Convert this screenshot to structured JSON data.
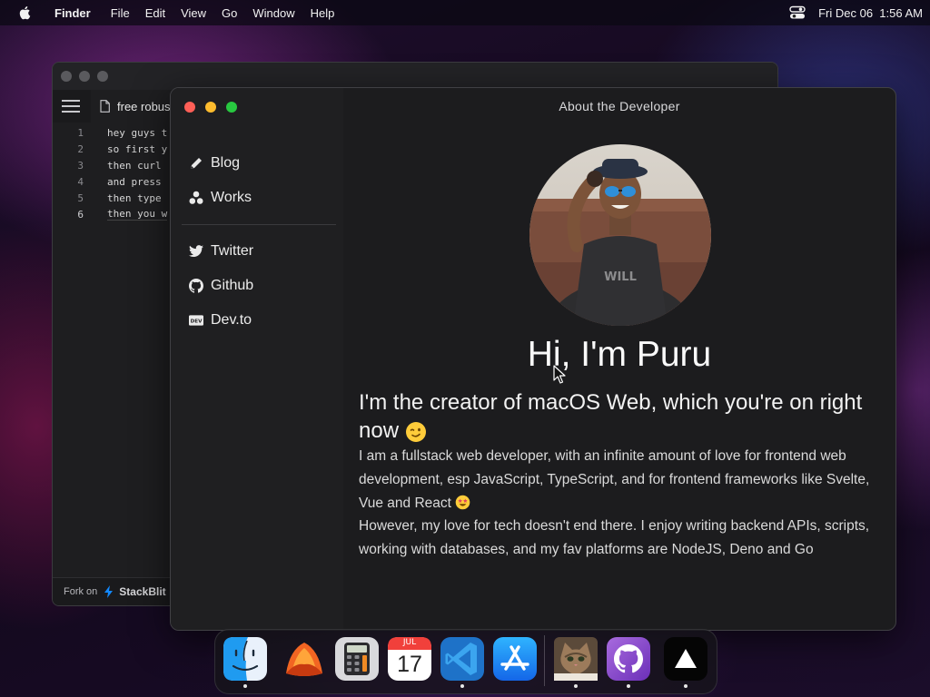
{
  "menubar": {
    "app_name": "Finder",
    "menus": [
      "File",
      "Edit",
      "View",
      "Go",
      "Window",
      "Help"
    ],
    "datetime": "Fri Dec 06  1:56 AM"
  },
  "editor": {
    "tab_label": "free robus",
    "lines": [
      {
        "num": "1",
        "text": "hey guys t"
      },
      {
        "num": "2",
        "text": "so first y"
      },
      {
        "num": "3",
        "text": "then curl"
      },
      {
        "num": "4",
        "text": "and press"
      },
      {
        "num": "5",
        "text": "then type"
      },
      {
        "num": "6",
        "text": "then you w"
      }
    ],
    "footer_fork": "Fork on",
    "footer_brand": "StackBlit"
  },
  "about": {
    "window_title": "About the Developer",
    "nav": [
      {
        "label": "Blog",
        "icon": "pencil-icon"
      },
      {
        "label": "Works",
        "icon": "works-icon"
      },
      {
        "label": "Twitter",
        "icon": "twitter-icon"
      },
      {
        "label": "Github",
        "icon": "github-icon"
      },
      {
        "label": "Dev.to",
        "icon": "devto-icon"
      }
    ],
    "heading": "Hi, I'm Puru",
    "subheading": "I'm the creator of macOS Web, which you're on right now",
    "paragraph1": "I am a fullstack web developer, with an infinite amount of love for frontend web development, esp JavaScript, TypeScript, and for frontend frameworks like Svelte, Vue and React",
    "paragraph2": "However, my love for tech doesn't end there. I enjoy writing backend APIs, scripts, working with databases, and my fav platforms are NodeJS, Deno and Go"
  },
  "dock": {
    "items": [
      {
        "name": "Finder",
        "icon": "finder-icon",
        "running": true
      },
      {
        "name": "Wallpapers",
        "icon": "wallpapers-icon",
        "running": false
      },
      {
        "name": "Calculator",
        "icon": "calculator-icon",
        "running": false
      },
      {
        "name": "Calendar",
        "icon": "calendar-icon",
        "running": false
      },
      {
        "name": "VS Code",
        "icon": "vscode-icon",
        "running": true
      },
      {
        "name": "App Store",
        "icon": "appstore-icon",
        "running": false
      },
      {
        "name": "Purus Twitter",
        "icon": "cat-icon",
        "running": true
      },
      {
        "name": "GitHub",
        "icon": "github-dock-icon",
        "running": true
      },
      {
        "name": "Vercel",
        "icon": "vercel-icon",
        "running": true
      }
    ],
    "calendar_month": "JUL",
    "calendar_day": "17"
  },
  "colors": {
    "traffic_close": "#ff5f57",
    "traffic_minimize": "#febc2e",
    "traffic_zoom": "#28c840",
    "window_bg": "#1c1c1e"
  }
}
